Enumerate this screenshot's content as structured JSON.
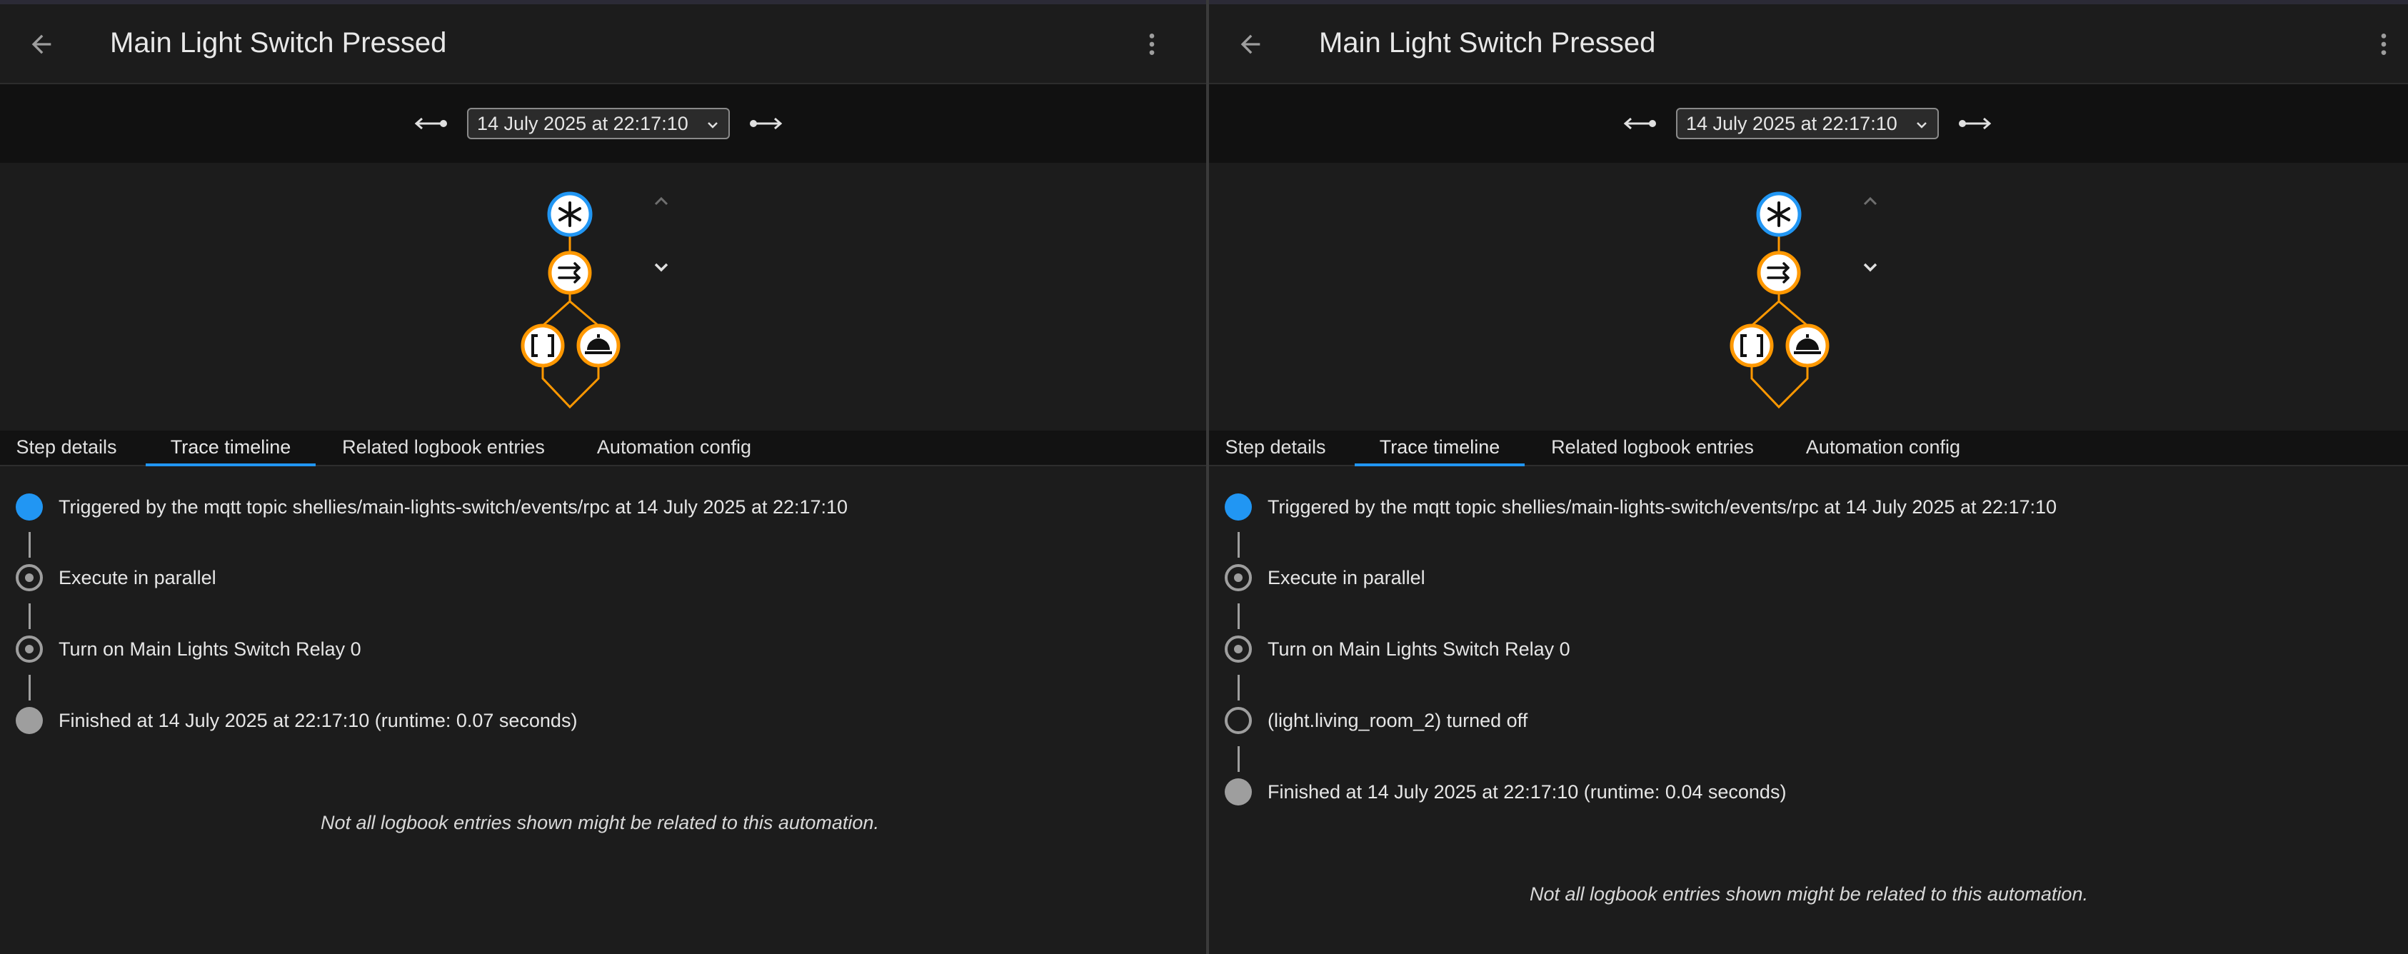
{
  "colors": {
    "background": "#1c1c1c",
    "toolbar": "#111111",
    "accent_blue": "#2196f3",
    "node_orange": "#ff9800",
    "trigger_dot": "#2196f3",
    "finished_dot": "#9e9e9e"
  },
  "panels": [
    {
      "header": {
        "title": "Main Light Switch Pressed",
        "back_icon": "arrow-left-icon",
        "menu_icon": "dots-vertical-icon"
      },
      "toolbar": {
        "selected_trace": "14 July 2025 at 22:17:10",
        "older_icon": "ray-end-arrow-icon",
        "newer_icon": "ray-start-arrow-icon"
      },
      "graph": {
        "nodes": [
          "trigger-node-asterisk-icon",
          "parallel-node-arrows-icon",
          "sequence-node-brackets-icon",
          "action-node-service-bell-icon"
        ],
        "nav_up_icon": "chevron-up-icon",
        "nav_down_icon": "chevron-down-icon"
      },
      "tabs": [
        {
          "label": "Step details"
        },
        {
          "label": "Trace timeline",
          "active": true
        },
        {
          "label": "Related logbook entries"
        },
        {
          "label": "Automation config"
        }
      ],
      "timeline": [
        {
          "icon": "trigger-dot-icon",
          "text": "Triggered by the mqtt topic shellies/main-lights-switch/events/rpc at 14 July 2025 at 22:17:10"
        },
        {
          "icon": "step-ring-icon",
          "text": "Execute in parallel"
        },
        {
          "icon": "step-ring-icon",
          "text": "Turn on Main Lights Switch Relay 0"
        },
        {
          "icon": "finished-dot-icon",
          "text": "Finished at 14 July 2025 at 22:17:10 (runtime: 0.07 seconds)"
        }
      ],
      "note": "Not all logbook entries shown might be related to this automation."
    },
    {
      "header": {
        "title": "Main Light Switch Pressed",
        "back_icon": "arrow-left-icon",
        "menu_icon": "dots-vertical-icon"
      },
      "toolbar": {
        "selected_trace": "14 July 2025 at 22:17:10",
        "older_icon": "ray-end-arrow-icon",
        "newer_icon": "ray-start-arrow-icon"
      },
      "graph": {
        "nodes": [
          "trigger-node-asterisk-icon",
          "parallel-node-arrows-icon",
          "sequence-node-brackets-icon",
          "action-node-service-bell-icon"
        ],
        "nav_up_icon": "chevron-up-icon",
        "nav_down_icon": "chevron-down-icon"
      },
      "tabs": [
        {
          "label": "Step details"
        },
        {
          "label": "Trace timeline",
          "active": true
        },
        {
          "label": "Related logbook entries"
        },
        {
          "label": "Automation config"
        }
      ],
      "timeline": [
        {
          "icon": "trigger-dot-icon",
          "text": "Triggered by the mqtt topic shellies/main-lights-switch/events/rpc at 14 July 2025 at 22:17:10"
        },
        {
          "icon": "step-ring-icon",
          "text": "Execute in parallel"
        },
        {
          "icon": "step-ring-icon",
          "text": "Turn on Main Lights Switch Relay 0"
        },
        {
          "icon": "empty-ring-icon",
          "text": "(light.living_room_2) turned off"
        },
        {
          "icon": "finished-dot-icon",
          "text": "Finished at 14 July 2025 at 22:17:10 (runtime: 0.04 seconds)"
        }
      ],
      "note": "Not all logbook entries shown might be related to this automation."
    }
  ]
}
